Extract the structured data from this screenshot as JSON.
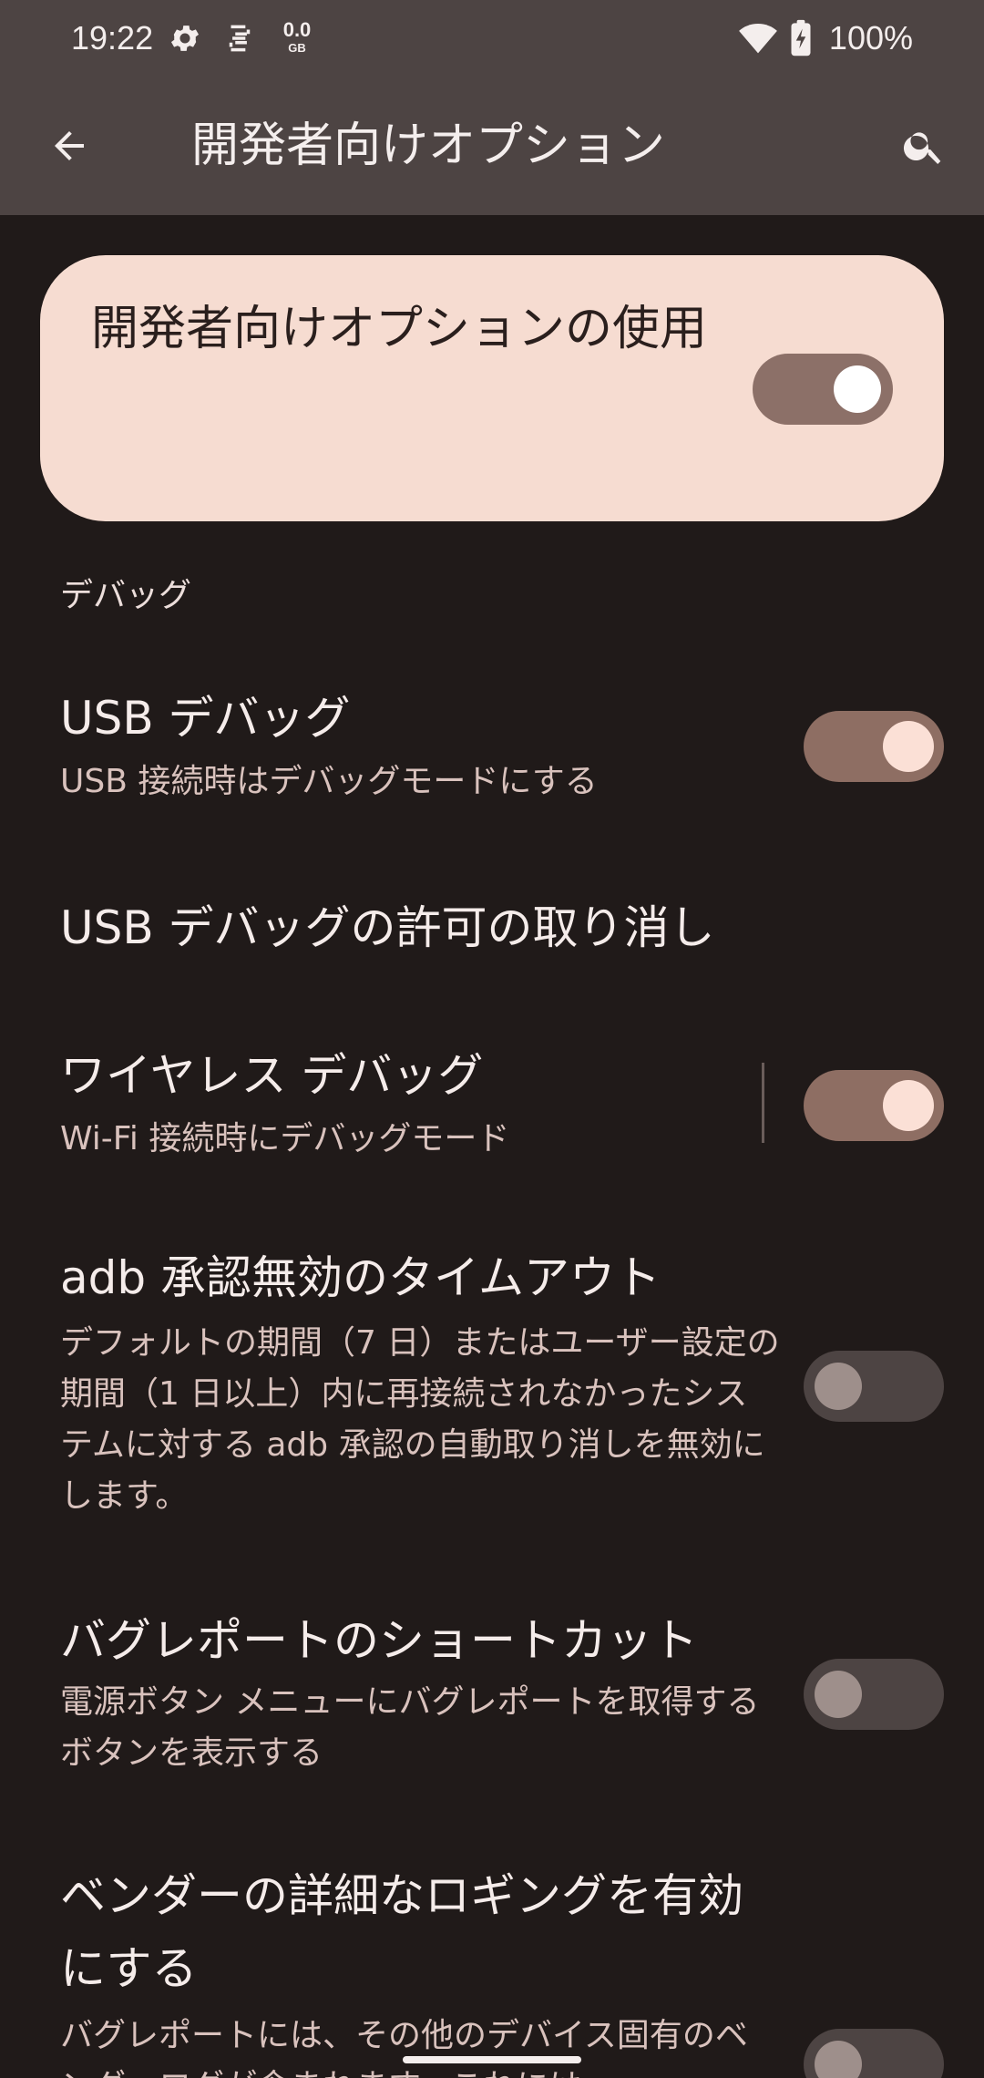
{
  "status_bar": {
    "time": "19:22",
    "data_value": "0.0",
    "data_unit": "GB",
    "battery": "100%"
  },
  "app_bar": {
    "title": "開発者向けオプション",
    "back_icon": "arrow-back-icon",
    "search_icon": "search-icon"
  },
  "main_switch": {
    "label": "開発者向けオプションの使用",
    "on": true
  },
  "sections": {
    "debug_header": "デバッグ"
  },
  "items": [
    {
      "title": "USB デバッグ",
      "summary": "USB 接続時はデバッグモードにする",
      "switch": "on"
    },
    {
      "title": "USB デバッグの許可の取り消し",
      "summary": "",
      "switch": "none"
    },
    {
      "title": "ワイヤレス デバッグ",
      "summary": "Wi-Fi 接続時にデバッグモード",
      "switch": "on"
    },
    {
      "title": "adb 承認無効のタイムアウト",
      "summary": "デフォルトの期間（7 日）またはユーザー設定の期間（1 日以上）内に再接続されなかったシステムに対する adb 承認の自動取り消しを無効にします。",
      "switch": "off"
    },
    {
      "title": "バグレポートのショートカット",
      "summary": "電源ボタン メニューにバグレポートを取得するボタンを表示する",
      "switch": "off"
    },
    {
      "title": "ベンダーの詳細なロギングを有効にする",
      "summary": "バグレポートには、その他のデバイス固有のベンダーログが含まれます。これには",
      "switch": "off"
    }
  ],
  "colors": {
    "background": "#201a19",
    "top_bar": "#4d4443",
    "card": "#f6dcd1",
    "switch_on_track": "#8e6e63",
    "switch_off_track": "#4d4443"
  }
}
